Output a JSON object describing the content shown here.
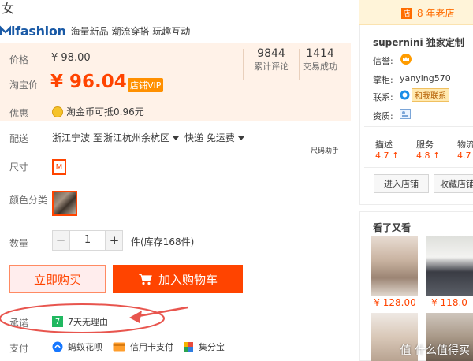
{
  "product": {
    "title": "女",
    "brand_logo": "ifashion",
    "brand_slogan": "海量新品 潮流穿搭 玩趣互动"
  },
  "price": {
    "original_label": "价格",
    "original_value": "¥ 98.00",
    "taobao_label": "淘宝价",
    "taobao_value": "¥ 96.04",
    "vip_badge": "店铺VIP",
    "stat1_num": "9844",
    "stat1_label": "累计评论",
    "stat2_num": "1414",
    "stat2_label": "交易成功",
    "promo_label": "优惠",
    "promo_text": "淘金币可抵0.96元"
  },
  "delivery": {
    "label": "配送",
    "from": "浙江宁波 至",
    "to": "浙江杭州余杭区",
    "method": "快递 免运费",
    "size_helper": "尺码助手"
  },
  "options": {
    "size_label": "尺寸",
    "size_value": "M",
    "color_label": "颜色分类",
    "qty_label": "数量",
    "qty_minus": "−",
    "qty_value": "1",
    "qty_plus": "+",
    "qty_unit": "件(库存168件)"
  },
  "actions": {
    "buy_now": "立即购买",
    "add_cart": "加入购物车"
  },
  "promise": {
    "label": "承诺",
    "icon_text": "7",
    "text": "7天无理由"
  },
  "payment": {
    "label": "支付",
    "methods": [
      "蚂蚁花呗",
      "信用卡支付",
      "集分宝"
    ]
  },
  "shop": {
    "years_badge": "店",
    "years_text": "8 年老店",
    "name": "supernini 独家定制",
    "credit_label": "信誉:",
    "keeper_label": "掌柜:",
    "keeper_value": "yanying570",
    "contact_label": "联系:",
    "contact_button": "和我联系",
    "qual_label": "资质:",
    "scores": [
      {
        "label": "描述",
        "value": "4.7"
      },
      {
        "label": "服务",
        "value": "4.8"
      },
      {
        "label": "物流",
        "value": "4.7"
      }
    ],
    "enter_button": "进入店铺",
    "fav_button": "收藏店铺"
  },
  "also_seen": {
    "title": "看了又看",
    "prices": [
      "¥ 128.00",
      "¥ 118.0"
    ]
  },
  "watermark": "值 什么值得买",
  "colors": {
    "accent": "#ff4400",
    "price_bg": "#fff2e8",
    "annotation": "#e8554e"
  }
}
